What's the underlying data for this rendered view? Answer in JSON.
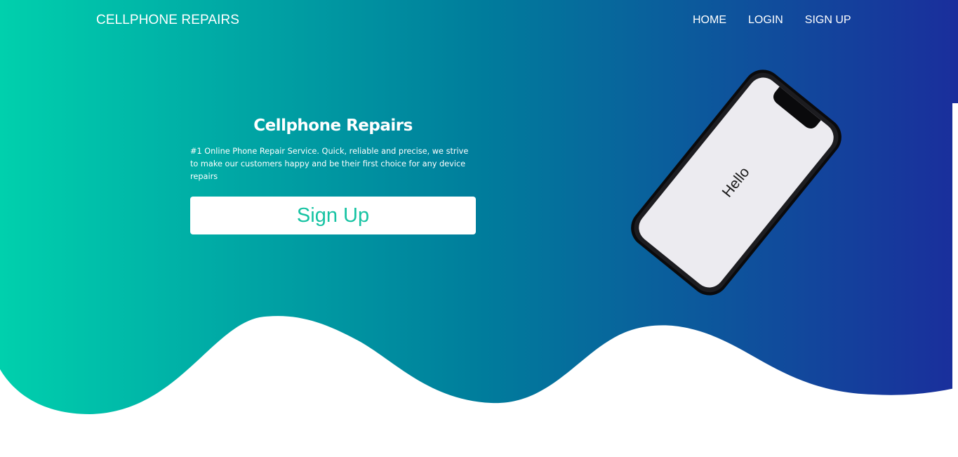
{
  "brand": {
    "name": "CELLPHONE REPAIRS"
  },
  "nav": {
    "items": [
      {
        "label": "HOME"
      },
      {
        "label": "LOGIN"
      },
      {
        "label": "SIGN UP"
      }
    ]
  },
  "hero": {
    "title": "Cellphone Repairs",
    "description": "#1 Online Phone Repair Service. Quick, reliable and precise, we strive to make our customers happy and be their first choice for any device repairs",
    "cta_label": "Sign Up",
    "phone_screen_text": "Hello"
  },
  "colors": {
    "gradient_start": "#00d0ad",
    "gradient_mid": "#007d9c",
    "gradient_end": "#1a2e9c",
    "cta_text": "#17c3a3",
    "background": "#ffffff"
  }
}
